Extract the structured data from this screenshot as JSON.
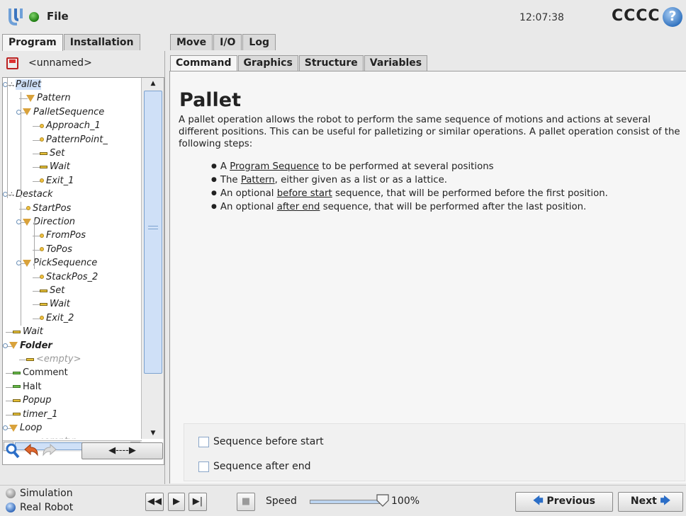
{
  "topbar": {
    "file_label": "File",
    "clock": "12:07:38",
    "robot_name": "CCCC",
    "help_glyph": "?"
  },
  "main_tabs": [
    "Program",
    "Installation",
    "Move",
    "I/O",
    "Log"
  ],
  "program": {
    "name": "<unnamed>"
  },
  "tree": [
    {
      "label": "Pallet",
      "icon": "pallet-icon",
      "depth": 0,
      "expandable": true,
      "selected": true
    },
    {
      "label": "Pattern",
      "icon": "folder-triangle-icon",
      "depth": 1
    },
    {
      "label": "PalletSequence",
      "icon": "folder-triangle-icon",
      "depth": 1,
      "expandable": true
    },
    {
      "label": "Approach_1",
      "icon": "waypoint-icon",
      "depth": 2
    },
    {
      "label": "PatternPoint_",
      "icon": "waypoint-icon",
      "depth": 2
    },
    {
      "label": "Set",
      "icon": "command-icon",
      "depth": 2
    },
    {
      "label": "Wait",
      "icon": "command-icon",
      "depth": 2
    },
    {
      "label": "Exit_1",
      "icon": "waypoint-icon",
      "depth": 2
    },
    {
      "label": "Destack",
      "icon": "pallet-icon",
      "depth": 0,
      "expandable": true
    },
    {
      "label": "StartPos",
      "icon": "waypoint-icon",
      "depth": 1
    },
    {
      "label": "Direction",
      "icon": "folder-triangle-icon",
      "depth": 1,
      "expandable": true
    },
    {
      "label": "FromPos",
      "icon": "waypoint-icon",
      "depth": 2
    },
    {
      "label": "ToPos",
      "icon": "waypoint-icon",
      "depth": 2
    },
    {
      "label": "PickSequence",
      "icon": "folder-triangle-icon",
      "depth": 1,
      "expandable": true
    },
    {
      "label": "StackPos_2",
      "icon": "waypoint-icon",
      "depth": 2
    },
    {
      "label": "Set",
      "icon": "command-icon",
      "depth": 2
    },
    {
      "label": "Wait",
      "icon": "command-icon",
      "depth": 2
    },
    {
      "label": "Exit_2",
      "icon": "waypoint-icon",
      "depth": 2
    },
    {
      "label": "Wait",
      "icon": "command-icon",
      "depth": 0
    },
    {
      "label": "Folder",
      "icon": "folder-triangle-icon",
      "depth": 0,
      "expandable": true,
      "bold": true
    },
    {
      "label": "<empty>",
      "icon": "command-icon",
      "depth": 1,
      "muted": true
    },
    {
      "label": "Comment",
      "icon": "comment-icon",
      "depth": 0,
      "normal": true
    },
    {
      "label": "Halt",
      "icon": "halt-icon",
      "depth": 0,
      "normal": true
    },
    {
      "label": "Popup",
      "icon": "command-icon",
      "depth": 0
    },
    {
      "label": "timer_1",
      "icon": "command-icon",
      "depth": 0
    },
    {
      "label": "Loop",
      "icon": "folder-triangle-icon",
      "depth": 0,
      "expandable": true
    },
    {
      "label": "<empty>",
      "icon": "command-icon",
      "depth": 1,
      "muted": true
    }
  ],
  "tree_tools": {
    "move_label": "◀----▶"
  },
  "sub_tabs": [
    "Command",
    "Graphics",
    "Structure",
    "Variables"
  ],
  "command": {
    "title": "Pallet",
    "description": "A pallet operation allows the robot to perform the same sequence of motions and actions at several different positions. This can be useful for palletizing or similar operations. A pallet operation consist of the following steps:",
    "bullets": [
      {
        "pre": "A ",
        "link": "Program Sequence",
        "post": " to be performed at several positions"
      },
      {
        "pre": "The ",
        "link": "Pattern",
        "post": ", either given as a list or as a lattice."
      },
      {
        "pre": "An optional ",
        "link": "before start",
        "post": " sequence, that will be performed before the first position."
      },
      {
        "pre": "An optional ",
        "link": "after end",
        "post": " sequence, that will be performed after the last position."
      }
    ],
    "options": [
      {
        "label": "Sequence before start",
        "checked": false
      },
      {
        "label": "Sequence after end",
        "checked": false
      }
    ]
  },
  "bottom": {
    "mode_simulation": "Simulation",
    "mode_real": "Real Robot",
    "selected_mode": "Real Robot",
    "speed_label": "Speed",
    "speed_value": "100%",
    "speed_fraction": 1.0,
    "previous_label": "Previous",
    "next_label": "Next"
  },
  "colors": {
    "selection": "#cfe0f7",
    "accent": "#2b6ec7",
    "background": "#e9e9e9"
  }
}
